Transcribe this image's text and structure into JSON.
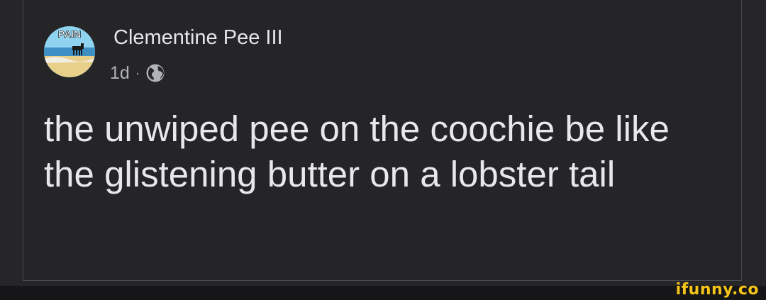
{
  "post": {
    "author": "Clementine Pee III",
    "time": "1d",
    "separator": "·",
    "privacy_icon": "globe-icon",
    "text": "the unwiped pee on the coochie be like the glistening butter on a lobster tail"
  },
  "avatar": {
    "caption": "PAIN"
  },
  "watermark": {
    "text": "ifunny.co"
  },
  "colors": {
    "background": "#262628",
    "text": "#e8e8ea",
    "secondary": "#b0b3b8",
    "watermark": "#f5c518"
  }
}
